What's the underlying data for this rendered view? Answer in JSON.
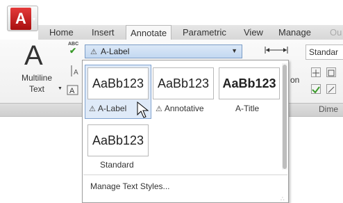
{
  "app_button": {
    "letter": "A",
    "caret": "▾"
  },
  "tabs": [
    {
      "label": "Home"
    },
    {
      "label": "Insert"
    },
    {
      "label": "Annotate"
    },
    {
      "label": "Parametric"
    },
    {
      "label": "View"
    },
    {
      "label": "Manage"
    },
    {
      "label": "Ou"
    }
  ],
  "active_tab": "Annotate",
  "ribbon": {
    "big_letter": "A",
    "multiline_text_line1": "Multiline",
    "multiline_text_line2": "Text",
    "spell_check_abc": "ABC",
    "dimension_partial": "on"
  },
  "text_style_combo": {
    "value": "A-Label",
    "icon": "annotative-triangle-icon"
  },
  "dimension_style_combo": {
    "value": "Standar"
  },
  "dimensions_panel_title": "Dime",
  "gallery": {
    "styles": [
      {
        "preview": "AaBb123",
        "label": "A-Label",
        "annotative": true,
        "selected": true,
        "bold": false
      },
      {
        "preview": "AaBb123",
        "label": "Annotative",
        "annotative": true,
        "selected": false,
        "bold": false
      },
      {
        "preview": "AaBb123",
        "label": "A-Title",
        "annotative": false,
        "selected": false,
        "bold": true
      },
      {
        "preview": "AaBb123",
        "label": "Standard",
        "annotative": false,
        "selected": false,
        "bold": false
      }
    ],
    "manage_link": "Manage Text Styles..."
  },
  "colors": {
    "accent_blue": "#7a9cc6",
    "selection_fill": "#dfeaf8",
    "app_red": "#c0161b"
  }
}
